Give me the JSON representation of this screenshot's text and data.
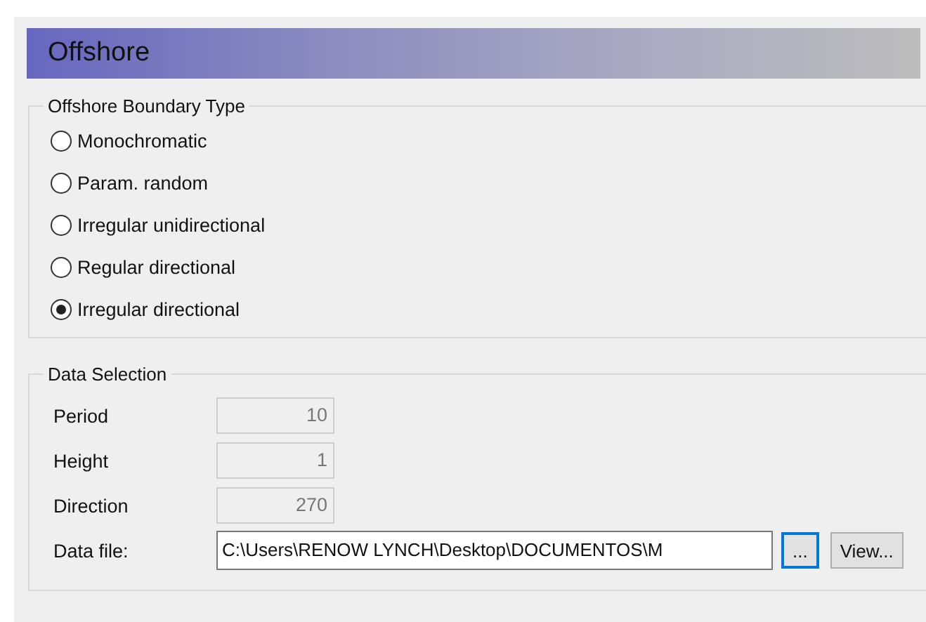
{
  "panel": {
    "title": "Offshore"
  },
  "boundary_type": {
    "legend": "Offshore Boundary Type",
    "options": [
      {
        "label": "Monochromatic",
        "selected": false
      },
      {
        "label": "Param. random",
        "selected": false
      },
      {
        "label": "Irregular unidirectional",
        "selected": false
      },
      {
        "label": "Regular directional",
        "selected": false
      },
      {
        "label": "Irregular directional",
        "selected": true
      }
    ]
  },
  "data_selection": {
    "legend": "Data Selection",
    "fields": [
      {
        "label": "Period",
        "value": "10",
        "disabled": true
      },
      {
        "label": "Height",
        "value": "1",
        "disabled": true
      },
      {
        "label": "Direction",
        "value": "270",
        "disabled": true
      }
    ],
    "data_file": {
      "label": "Data file:",
      "value": "C:\\Users\\RENOW LYNCH\\Desktop\\DOCUMENTOS\\M",
      "browse_button": {
        "label": "...",
        "focused": true
      },
      "view_button": {
        "label": "View..."
      }
    }
  }
}
